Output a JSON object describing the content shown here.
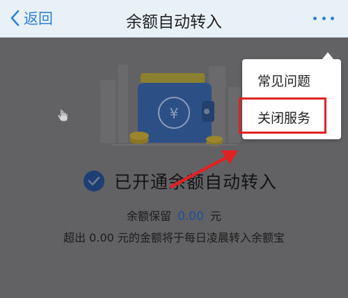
{
  "header": {
    "back_label": "返回",
    "title": "余额自动转入"
  },
  "status": {
    "text": "已开通余额自动转入"
  },
  "retain": {
    "prefix": "余额保留",
    "amount": "0.00",
    "suffix": "元"
  },
  "description": "超出 0.00 元的金额将于每日凌晨转入余额宝",
  "menu": {
    "items": [
      {
        "label": "常见问题"
      },
      {
        "label": "关闭服务"
      }
    ]
  },
  "colors": {
    "accent": "#2f7fd8",
    "highlight": "#e12024",
    "dim": "#626264"
  }
}
